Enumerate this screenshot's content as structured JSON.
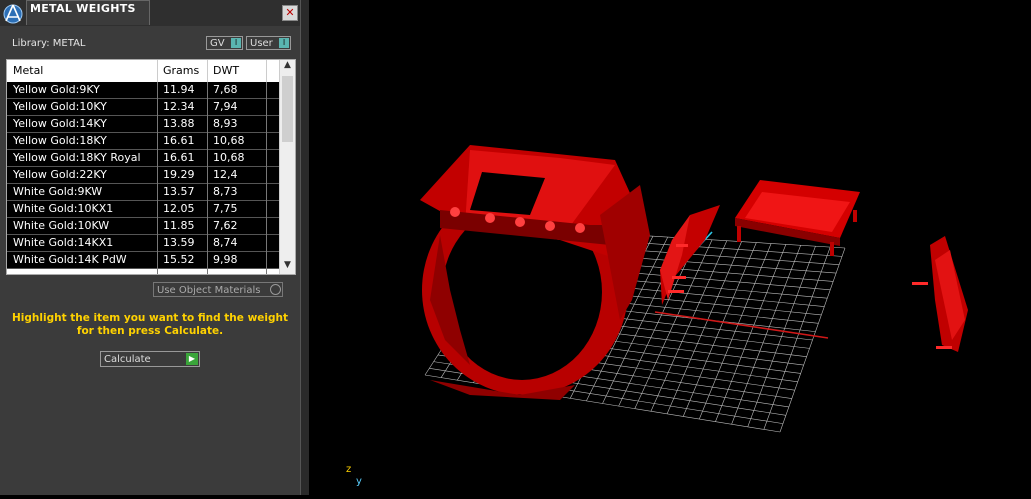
{
  "panel": {
    "title": "METAL WEIGHTS",
    "close_symbol": "✕",
    "library_label": "Library: METAL",
    "toggle_gv": "GV",
    "toggle_user": "User",
    "toggle_state": "I",
    "use_object_materials": "Use Object Materials",
    "hint_line1": "Highlight the item you want to find the weight",
    "hint_line2": "for then press Calculate.",
    "calculate_label": "Calculate"
  },
  "table": {
    "columns": [
      "Metal",
      "Grams",
      "DWT"
    ],
    "rows": [
      {
        "metal": "Yellow Gold:9KY",
        "grams": "11.94",
        "dwt": "7,68"
      },
      {
        "metal": "Yellow Gold:10KY",
        "grams": "12.34",
        "dwt": "7,94"
      },
      {
        "metal": "Yellow Gold:14KY",
        "grams": "13.88",
        "dwt": "8,93"
      },
      {
        "metal": "Yellow Gold:18KY",
        "grams": "16.61",
        "dwt": "10,68"
      },
      {
        "metal": "Yellow Gold:18KY Royal",
        "grams": "16.61",
        "dwt": "10,68"
      },
      {
        "metal": "Yellow Gold:22KY",
        "grams": "19.29",
        "dwt": "12,4"
      },
      {
        "metal": "White Gold:9KW",
        "grams": "13.57",
        "dwt": "8,73"
      },
      {
        "metal": "White Gold:10KX1",
        "grams": "12.05",
        "dwt": "7,75"
      },
      {
        "metal": "White Gold:10KW",
        "grams": "11.85",
        "dwt": "7,62"
      },
      {
        "metal": "White Gold:14KX1",
        "grams": "13.59",
        "dwt": "8,74"
      },
      {
        "metal": "White Gold:14K PdW",
        "grams": "15.52",
        "dwt": "9,98"
      }
    ]
  },
  "viewport": {
    "axis_z": "z",
    "axis_y": "y"
  },
  "colors": {
    "model": "#c00000",
    "grid": "#bdbdbd",
    "hint": "#ffd200"
  }
}
